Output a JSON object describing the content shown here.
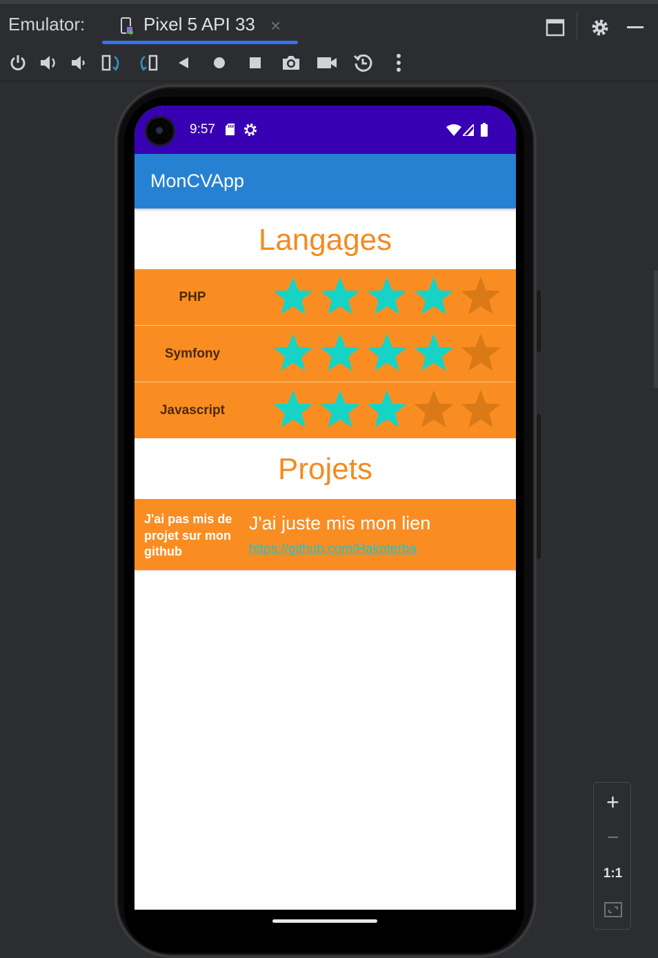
{
  "ide": {
    "panel_title": "Emulator:",
    "tab": {
      "label": "Pixel 5 API 33",
      "close": "×",
      "icon": "device-icon"
    },
    "window_buttons": [
      "restore-window-icon",
      "settings-gear-icon",
      "minimize-icon"
    ],
    "toolbar": [
      "power-icon",
      "volume-up-icon",
      "volume-down-icon",
      "rotate-left-icon",
      "rotate-right-icon",
      "back-icon",
      "home-icon",
      "overview-icon",
      "screenshot-camera-icon",
      "screen-record-icon",
      "snapshot-restore-icon",
      "more-options-icon"
    ],
    "zoom": {
      "zoom_in": "+",
      "zoom_out": "−",
      "actual_size": "1:1",
      "fit": "fit-screen-icon"
    }
  },
  "device": {
    "status": {
      "time": "9:57",
      "icons": [
        "sd-card-icon",
        "settings-status-icon",
        "wifi-icon",
        "cell-signal-icon",
        "battery-icon"
      ]
    },
    "app": {
      "title": "MonCVApp",
      "languages_heading": "Langages",
      "skills": [
        {
          "name": "PHP",
          "rating": 4,
          "max": 5
        },
        {
          "name": "Symfony",
          "rating": 4,
          "max": 5
        },
        {
          "name": "Javascript",
          "rating": 3,
          "max": 5
        }
      ],
      "projects_heading": "Projets",
      "project": {
        "description": "J'ai pas mis de projet sur mon github",
        "title": "J'ai juste mis mon lien",
        "link": "https://github.com/Hakoterba"
      }
    }
  },
  "colors": {
    "status_bar": "#3700b3",
    "app_bar": "#2781d3",
    "accent_orange": "#fa8d22",
    "heading_orange": "#f48a20",
    "star_filled": "#17d3c6",
    "star_empty": "#d97a16",
    "link": "#1fc3c9"
  }
}
